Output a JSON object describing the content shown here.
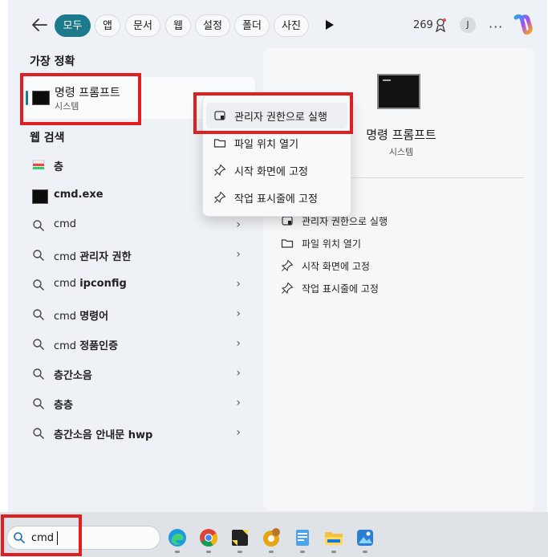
{
  "header": {
    "chips": [
      {
        "label": "모두",
        "active": true
      },
      {
        "label": "앱",
        "active": false
      },
      {
        "label": "문서",
        "active": false
      },
      {
        "label": "웹",
        "active": false
      },
      {
        "label": "설정",
        "active": false
      },
      {
        "label": "폴더",
        "active": false
      },
      {
        "label": "사진",
        "active": false
      }
    ],
    "points": "269",
    "avatar_initial": "J",
    "more": "···"
  },
  "best_match": {
    "title": "가장 정확",
    "app_name": "명령 프롬프트",
    "app_type": "시스템"
  },
  "web_search": {
    "title": "웹 검색",
    "items": [
      {
        "icon": "layers-app-icon",
        "prefix": "",
        "bold": "층",
        "chevron": false
      },
      {
        "icon": "cmd-exe-icon",
        "prefix": "",
        "bold": "cmd.exe",
        "chevron": false
      },
      {
        "icon": "search-icon",
        "prefix": "cmd",
        "bold": "",
        "chevron": true
      },
      {
        "icon": "search-icon",
        "prefix": "cmd ",
        "bold": "관리자 권한",
        "chevron": true
      },
      {
        "icon": "search-icon",
        "prefix": "cmd ",
        "bold": "ipconfig",
        "chevron": true
      },
      {
        "icon": "search-icon",
        "prefix": "cmd ",
        "bold": "명령어",
        "chevron": true
      },
      {
        "icon": "search-icon",
        "prefix": "cmd ",
        "bold": "정품인증",
        "chevron": true
      },
      {
        "icon": "search-icon",
        "prefix": "",
        "bold": "층간소음",
        "chevron": true
      },
      {
        "icon": "search-icon",
        "prefix": "",
        "bold": "층층",
        "chevron": true
      },
      {
        "icon": "search-icon",
        "prefix": "",
        "bold": "층간소음 안내문 hwp",
        "chevron": true
      }
    ],
    "chevron": "›"
  },
  "context_menu": {
    "items": [
      {
        "icon": "shield-icon",
        "label": "관리자 권한으로 실행"
      },
      {
        "icon": "folder-icon",
        "label": "파일 위치 열기"
      },
      {
        "icon": "pin-icon",
        "label": "시작 화면에 고정"
      },
      {
        "icon": "pin-icon",
        "label": "작업 표시줄에 고정"
      }
    ]
  },
  "right_panel": {
    "title": "명령 프롬프트",
    "subtitle": "시스템",
    "actions": [
      {
        "icon": "shield-icon",
        "label": "관리자 권한으로 실행"
      },
      {
        "icon": "folder-icon",
        "label": "파일 위치 열기"
      },
      {
        "icon": "pin-icon",
        "label": "시작 화면에 고정"
      },
      {
        "icon": "pin-icon",
        "label": "작업 표시줄에 고정"
      }
    ]
  },
  "taskbar": {
    "search_value": "cmd",
    "apps": [
      "edge-icon",
      "chrome-icon",
      "sticky-notes-icon",
      "chrome-canary-icon",
      "notepad-icon",
      "file-explorer-icon",
      "photos-icon"
    ]
  },
  "colors": {
    "accent": "#1b7a8c",
    "highlight": "#e02020"
  }
}
